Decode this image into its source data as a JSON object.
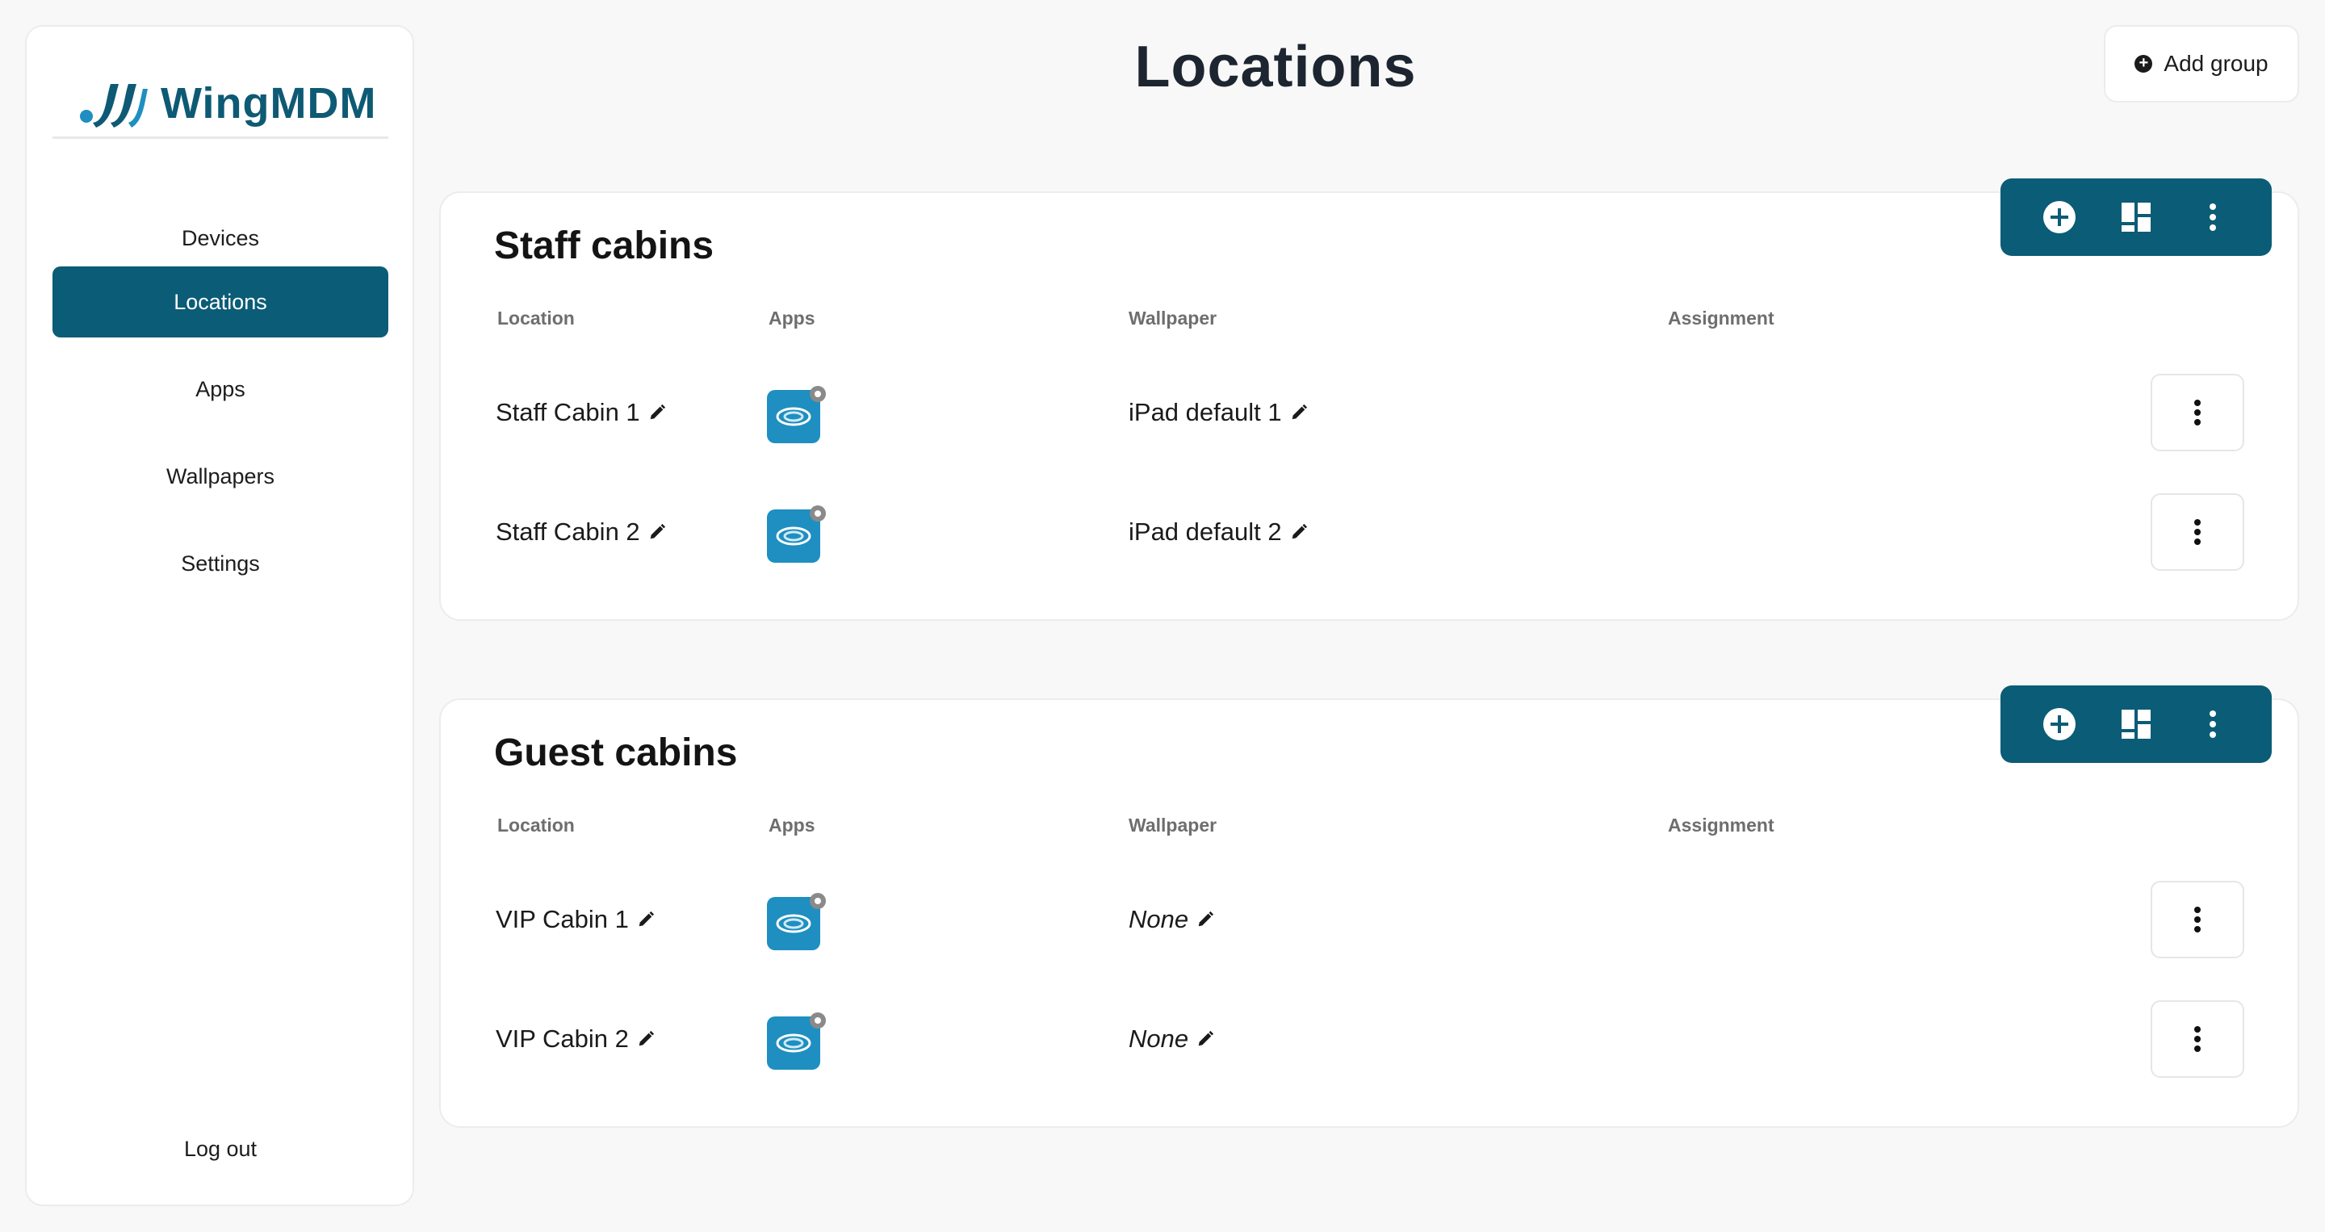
{
  "brand": {
    "name": "WingMDM",
    "accent": "#0b5c76"
  },
  "sidebar": {
    "items": [
      {
        "label": "Devices",
        "active": false
      },
      {
        "label": "Locations",
        "active": true
      },
      {
        "label": "Apps",
        "active": false
      },
      {
        "label": "Wallpapers",
        "active": false
      },
      {
        "label": "Settings",
        "active": false
      }
    ],
    "logout": "Log out"
  },
  "header": {
    "title": "Locations",
    "add_group": "Add group"
  },
  "columns": {
    "location": "Location",
    "apps": "Apps",
    "wallpaper": "Wallpaper",
    "assignment": "Assignment"
  },
  "groups": [
    {
      "title": "Staff cabins",
      "rows": [
        {
          "location": "Staff Cabin 1",
          "wallpaper": "iPad default 1",
          "assignment": ""
        },
        {
          "location": "Staff Cabin 2",
          "wallpaper": "iPad default 2",
          "assignment": ""
        }
      ]
    },
    {
      "title": "Guest cabins",
      "rows": [
        {
          "location": "VIP Cabin 1",
          "wallpaper": "None",
          "assignment": ""
        },
        {
          "location": "VIP Cabin 2",
          "wallpaper": "None",
          "assignment": ""
        }
      ]
    }
  ],
  "icons": {
    "group_toolbar": [
      "plus-circle-icon",
      "layout-grid-icon",
      "more-vertical-icon"
    ],
    "row": [
      "pencil-icon",
      "app-icon",
      "gear-icon",
      "more-vertical-icon"
    ]
  }
}
